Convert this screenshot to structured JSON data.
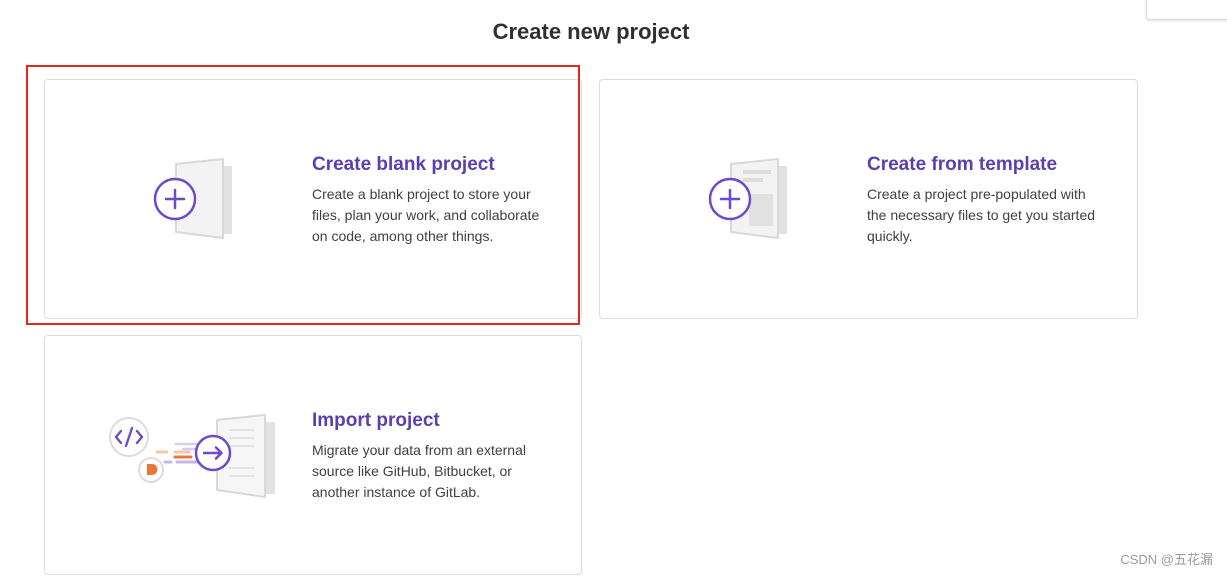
{
  "page": {
    "title": "Create new project",
    "watermark": "CSDN @五花漏"
  },
  "cards": [
    {
      "id": "blank",
      "title": "Create blank project",
      "description": "Create a blank project to store your files, plan your work, and collaborate on code, among other things.",
      "illustration": "blank-document-plus-icon",
      "highlighted": true
    },
    {
      "id": "template",
      "title": "Create from template",
      "description": "Create a project pre-populated with the necessary files to get you started quickly.",
      "illustration": "template-document-plus-icon",
      "highlighted": false
    },
    {
      "id": "import",
      "title": "Import project",
      "description": "Migrate your data from an external source like GitHub, Bitbucket, or another instance of GitLab.",
      "illustration": "import-arrow-icon",
      "highlighted": false
    }
  ],
  "colors": {
    "accent": "#6e49cb",
    "card_title": "#5b3fb0",
    "card_border": "#dcdcde",
    "highlight": "#e0281c",
    "import_dash_orange": "#e9773c"
  }
}
